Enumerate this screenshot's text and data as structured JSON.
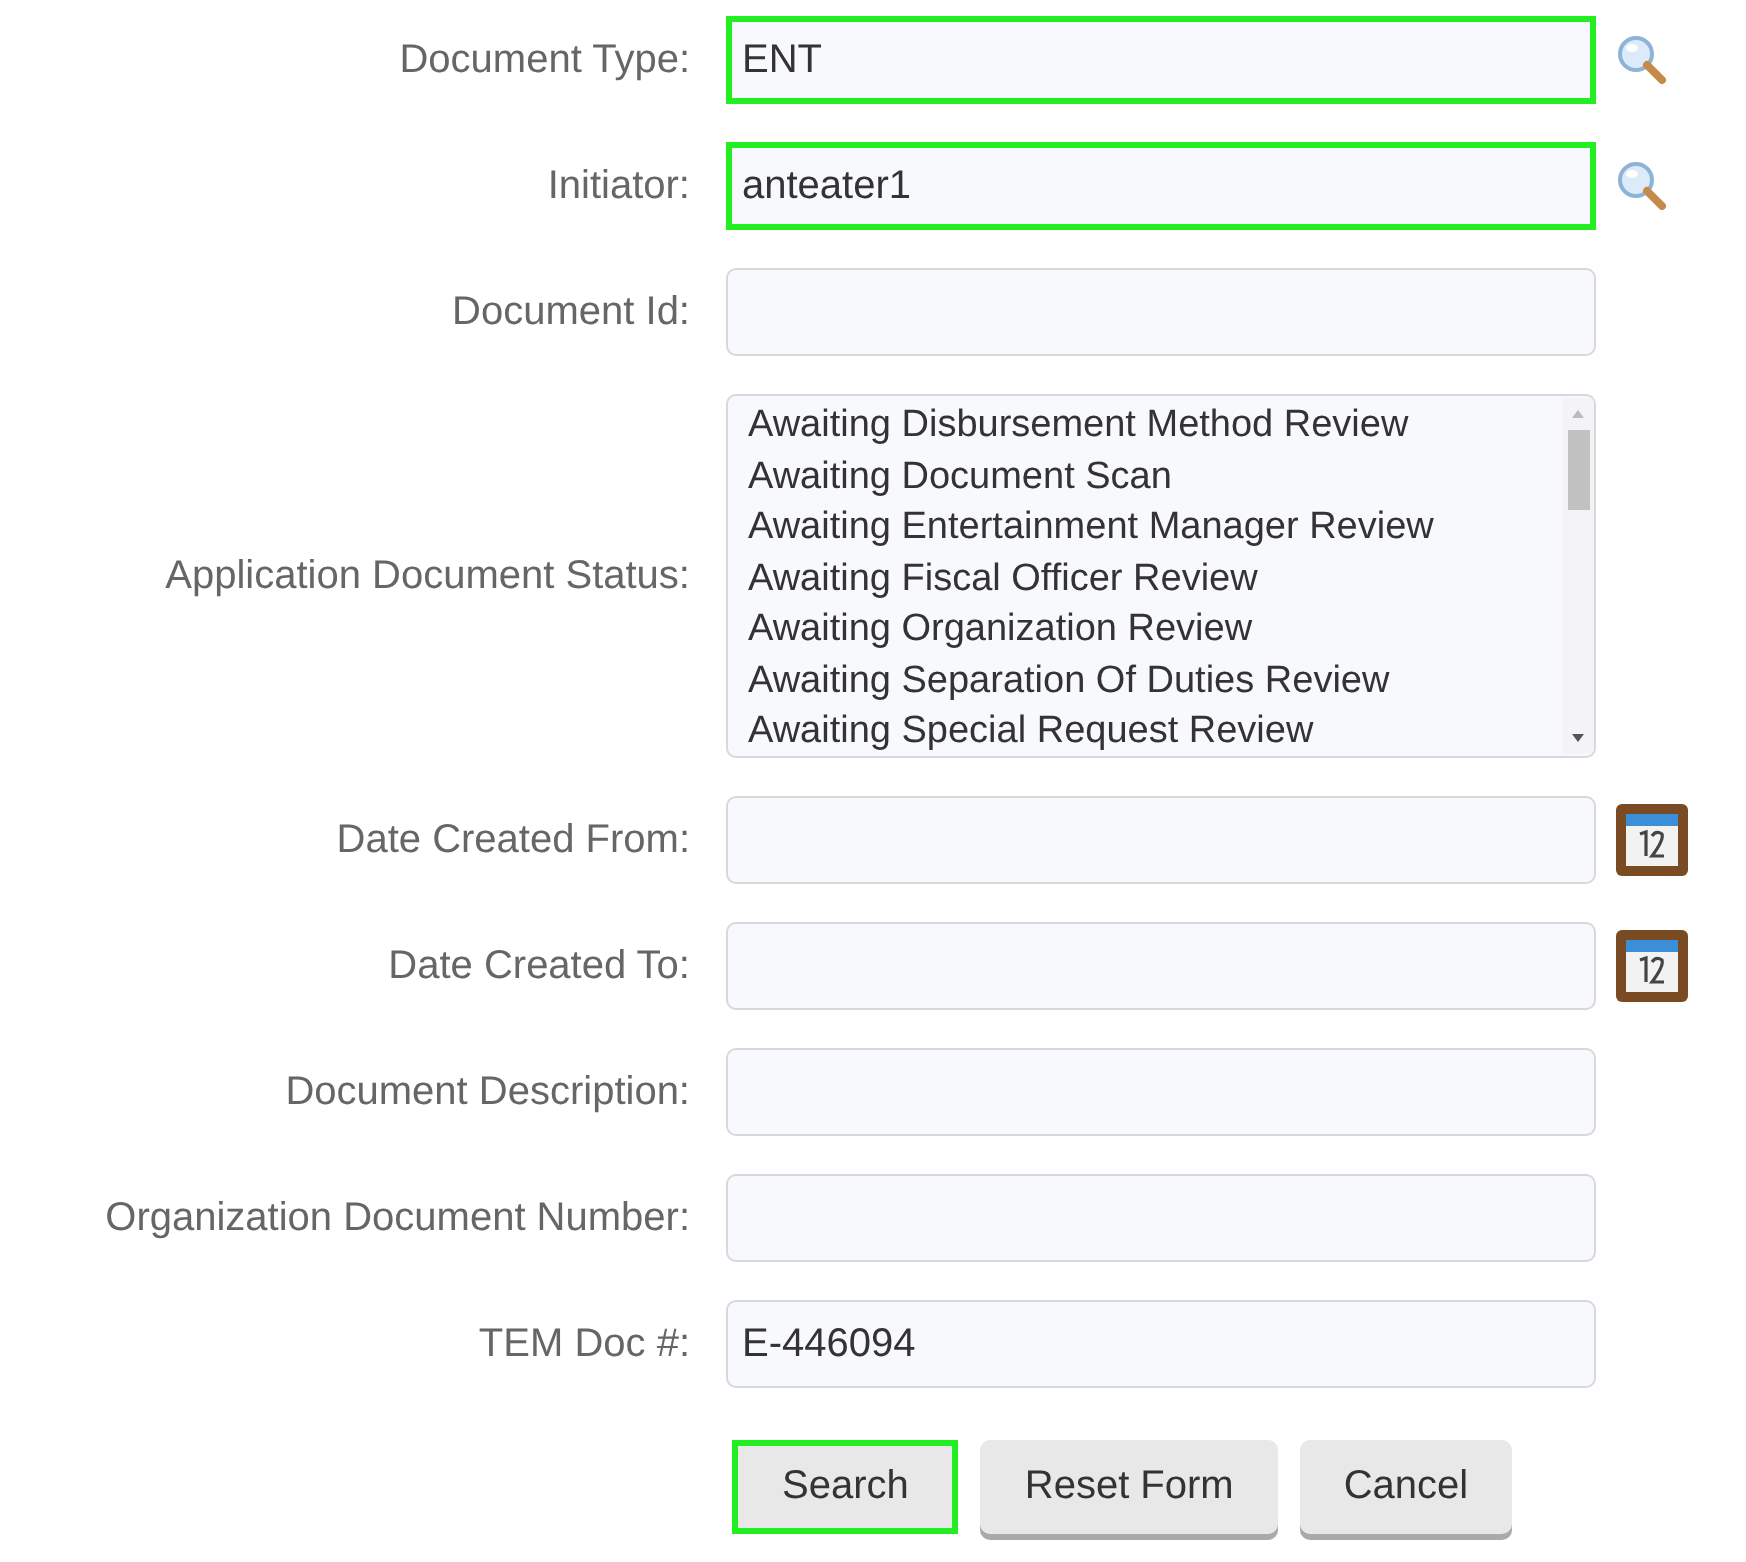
{
  "fields": [
    {
      "label": "Document Type:",
      "kind": "lookup",
      "value": "ENT",
      "highlighted": true
    },
    {
      "label": "Initiator:",
      "kind": "lookup",
      "value": "anteater1",
      "highlighted": true
    },
    {
      "label": "Document Id:",
      "kind": "text",
      "highlighted": false
    },
    {
      "label": "Application Document Status:",
      "kind": "listbox",
      "options": [
        "Awaiting Disbursement Method Review",
        "Awaiting Document Scan",
        "Awaiting Entertainment Manager Review",
        "Awaiting Fiscal Officer Review",
        "Awaiting Organization Review",
        "Awaiting Separation Of Duties Review",
        "Awaiting Special Request Review"
      ]
    },
    {
      "label": "Date Created From:",
      "kind": "date",
      "highlighted": false
    },
    {
      "label": "Date Created To:",
      "kind": "date",
      "highlighted": false
    },
    {
      "label": "Document Description:",
      "kind": "text",
      "highlighted": false
    },
    {
      "label": "Organization Document Number:",
      "kind": "text",
      "highlighted": false
    },
    {
      "label": "TEM Doc #:",
      "kind": "text",
      "value": "E-446094",
      "highlighted": false
    }
  ],
  "buttons": [
    {
      "label": "Search",
      "highlighted": true
    },
    {
      "label": "Reset Form",
      "highlighted": false
    },
    {
      "label": "Cancel",
      "highlighted": false
    }
  ]
}
